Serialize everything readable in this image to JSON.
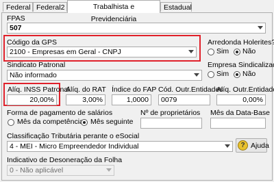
{
  "tabs": [
    {
      "label": "Federal"
    },
    {
      "label": "Federal2"
    },
    {
      "label": "Trabalhista e Previdenciária"
    },
    {
      "label": "Estadual"
    }
  ],
  "fpas": {
    "label": "FPAS",
    "value": "507"
  },
  "codigo_gps": {
    "label": "Código da GPS",
    "value": "2100 - Empresas em Geral - CNPJ"
  },
  "arredonda_holerites": {
    "label": "Arredonda Holerites?",
    "sim": "Sim",
    "nao": "Não",
    "selected": "Não"
  },
  "sindicato_patronal": {
    "label": "Sindicato Patronal",
    "value": "Não informado"
  },
  "empresa_sindicalizada": {
    "label": "Empresa Sindicalizada?",
    "sim": "Sim",
    "nao": "Não",
    "selected": "Não"
  },
  "aliq_inss_patronal": {
    "label": "Alíq. INSS Patronal",
    "value": "20,00%"
  },
  "aliq_rat": {
    "label": "Alíq. do RAT",
    "value": "3,00%"
  },
  "indice_fap": {
    "label": "Índice do FAP",
    "value": "1,0000"
  },
  "cod_outr_entidades": {
    "label": "Cód. Outr.Entidades",
    "value": "0079"
  },
  "aliq_outr_entidades": {
    "label": "Alíq. Outr.Entidades",
    "value": "0,00%"
  },
  "forma_pagamento": {
    "label": "Forma de pagamento de salários",
    "opt_competencia": "Mês da competência",
    "opt_seguinte": "Mês seguinte",
    "selected": "Mês seguinte"
  },
  "num_proprietarios": {
    "label": "Nº de proprietários",
    "value": ""
  },
  "mes_data_base": {
    "label": "Mês da Data-Base",
    "value": ""
  },
  "classificacao_tributaria": {
    "label": "Classificação Tributária perante o eSocial",
    "value": "4 - MEI - Micro Empreendedor Individual"
  },
  "ajuda_button": {
    "label": "Ajuda",
    "icon": "help-icon"
  },
  "indicativo_desoneracao": {
    "label": "Indicativo de Desoneração da Folha",
    "value": "0 - Não aplicável"
  },
  "colors": {
    "highlight": "#e0202a",
    "panel_bg": "#f0f0f0",
    "field_border": "#a9a9a9"
  }
}
